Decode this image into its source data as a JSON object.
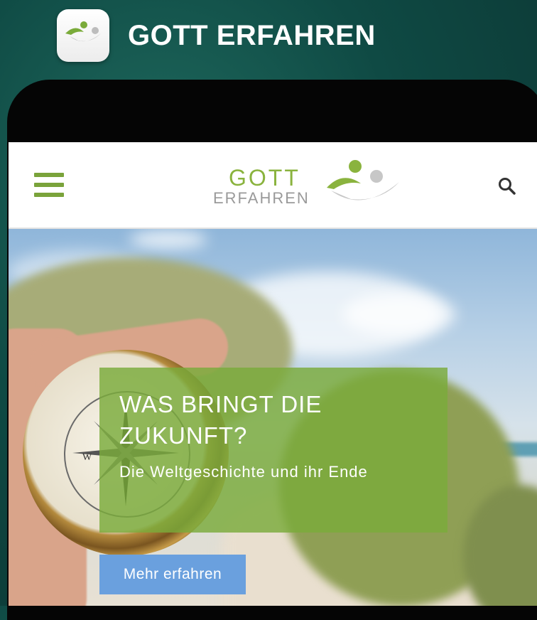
{
  "app": {
    "title": "GOTT ERFAHREN",
    "icon": "gott-erfahren-app-icon"
  },
  "site": {
    "menu_icon": "hamburger-menu-icon",
    "logo": {
      "line1": "GOTT",
      "line2": "ERFAHREN"
    },
    "search_icon": "search-icon"
  },
  "hero": {
    "headline": "WAS BRINGT DIE ZUKUNFT?",
    "subline": "Die Weltgeschichte und ihr Ende",
    "cta_label": "Mehr erfahren"
  },
  "colors": {
    "brand_green": "#8ab33e",
    "overlay_green": "#7aab3a",
    "cta_blue": "#6aa0de",
    "header_teal": "#0f4a44"
  }
}
